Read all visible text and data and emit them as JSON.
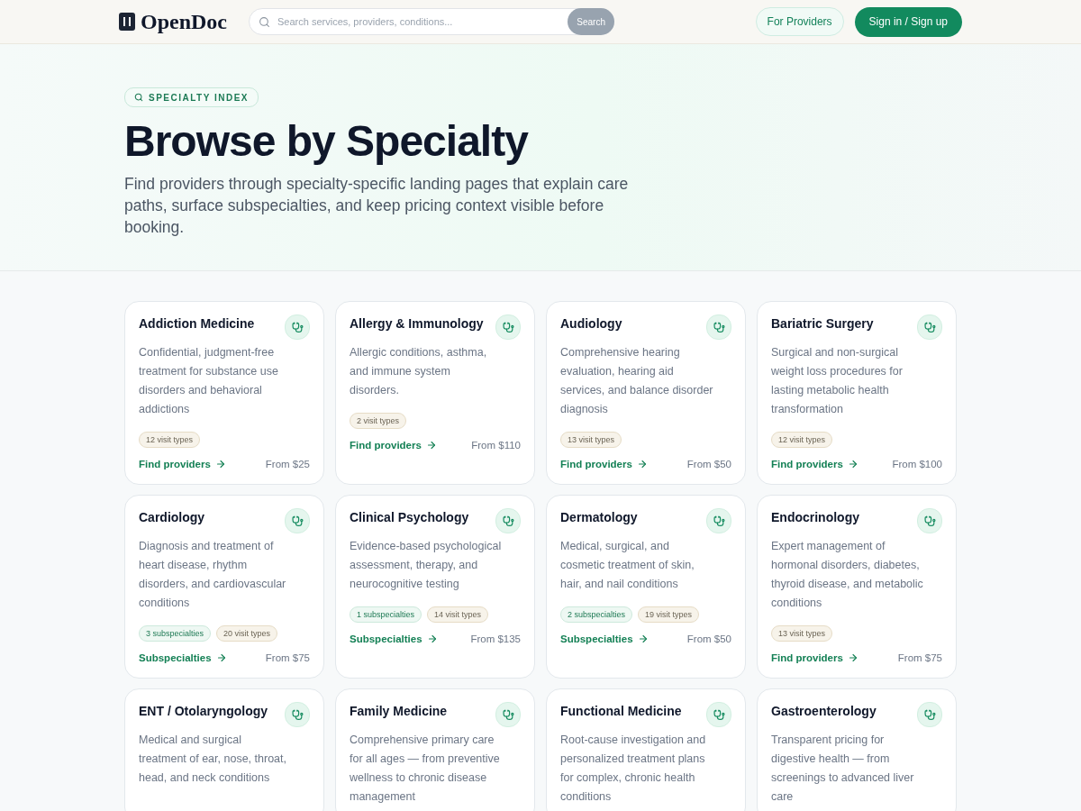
{
  "header": {
    "logo": "OpenDoc",
    "search": {
      "placeholder": "Search services, providers, conditions...",
      "button": "Search"
    },
    "for_providers": "For Providers",
    "sign_in": "Sign in / Sign up"
  },
  "hero": {
    "badge": "SPECIALTY INDEX",
    "title": "Browse by Specialty",
    "subtitle": "Find providers through specialty-specific landing pages that explain care paths, surface subspecialties, and keep pricing context visible before booking."
  },
  "cards": [
    {
      "title": "Addiction Medicine",
      "description": "Confidential, judgment-free treatment for substance use disorders and behavioral addictions",
      "tags": [
        {
          "kind": "visits",
          "label": "12 visit types"
        }
      ],
      "link": "Find providers",
      "price": "From $25"
    },
    {
      "title": "Allergy & Immunology",
      "description": "Allergic conditions, asthma, and immune system disorders.",
      "tags": [
        {
          "kind": "visits",
          "label": "2 visit types"
        }
      ],
      "link": "Find providers",
      "price": "From $110"
    },
    {
      "title": "Audiology",
      "description": "Comprehensive hearing evaluation, hearing aid services, and balance disorder diagnosis",
      "tags": [
        {
          "kind": "visits",
          "label": "13 visit types"
        }
      ],
      "link": "Find providers",
      "price": "From $50"
    },
    {
      "title": "Bariatric Surgery",
      "description": "Surgical and non-surgical weight loss procedures for lasting metabolic health transformation",
      "tags": [
        {
          "kind": "visits",
          "label": "12 visit types"
        }
      ],
      "link": "Find providers",
      "price": "From $100"
    },
    {
      "title": "Cardiology",
      "description": "Diagnosis and treatment of heart disease, rhythm disorders, and cardiovascular conditions",
      "tags": [
        {
          "kind": "subspecialties",
          "label": "3 subspecialties"
        },
        {
          "kind": "visits",
          "label": "20 visit types"
        }
      ],
      "link": "Subspecialties",
      "price": "From $75"
    },
    {
      "title": "Clinical Psychology",
      "description": "Evidence-based psychological assessment, therapy, and neurocognitive testing",
      "tags": [
        {
          "kind": "subspecialties",
          "label": "1 subspecialties"
        },
        {
          "kind": "visits",
          "label": "14 visit types"
        }
      ],
      "link": "Subspecialties",
      "price": "From $135"
    },
    {
      "title": "Dermatology",
      "description": "Medical, surgical, and cosmetic treatment of skin, hair, and nail conditions",
      "tags": [
        {
          "kind": "subspecialties",
          "label": "2 subspecialties"
        },
        {
          "kind": "visits",
          "label": "19 visit types"
        }
      ],
      "link": "Subspecialties",
      "price": "From $50"
    },
    {
      "title": "Endocrinology",
      "description": "Expert management of hormonal disorders, diabetes, thyroid disease, and metabolic conditions",
      "tags": [
        {
          "kind": "visits",
          "label": "13 visit types"
        }
      ],
      "link": "Find providers",
      "price": "From $75"
    },
    {
      "title": "ENT / Otolaryngology",
      "description": "Medical and surgical treatment of ear, nose, throat, head, and neck conditions"
    },
    {
      "title": "Family Medicine",
      "description": "Comprehensive primary care for all ages — from preventive wellness to chronic disease management"
    },
    {
      "title": "Functional Medicine",
      "description": "Root-cause investigation and personalized treatment plans for complex, chronic health conditions"
    },
    {
      "title": "Gastroenterology",
      "description": "Transparent pricing for digestive health — from screenings to advanced liver care"
    }
  ]
}
